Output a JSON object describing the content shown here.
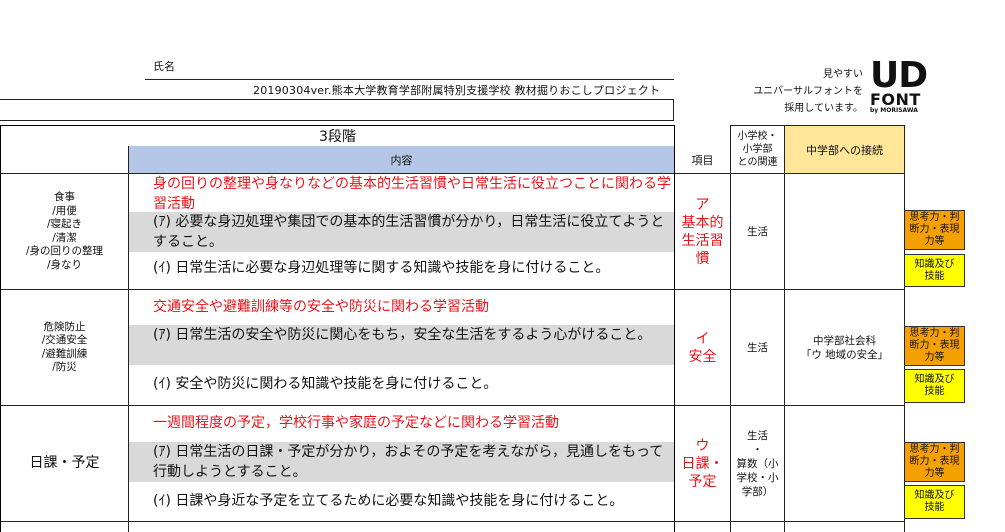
{
  "header": {
    "name_label": "氏名",
    "project_line": "20190304ver.熊本大学教育学部附属特別支援学校 教材掘りおこしプロジェクト"
  },
  "ud_font": {
    "tagline": "見やすい\nユニバーサルフォントを\n採用しています。",
    "logo_main": "UD",
    "logo_sub": "FONT",
    "logo_by": "by MORISAWA"
  },
  "table": {
    "stage": "3段階",
    "col_content": "内容",
    "col_item": "項目",
    "col_relation": "小学校・\n小学部\nとの関連",
    "col_junior": "中学部への接続",
    "rows": [
      {
        "category": "食事\n/用便\n/寝起き\n/清潔\n/身の回りの整理\n/身なり",
        "title": "身の回りの整理や身なりなどの基本的生活習慣や日常生活に役立つことに関わる学習活動",
        "objective_a": "(ｱ) 必要な身辺処理や集団での基本的生活習慣が分かり，日常生活に役立てようとすること。",
        "objective_b": "(ｲ) 日常生活に必要な身辺処理等に関する知識や技能を身に付けること。",
        "item": "ア\n基本的\n生活習\n慣",
        "relation": "生活",
        "junior": "",
        "tag_think": "思考力・判\n断力・表現\n力等",
        "tag_skill": "知識及び\n技能"
      },
      {
        "category": "危険防止\n/交通安全\n/避難訓練\n/防災",
        "title": "交通安全や避難訓練等の安全や防災に関わる学習活動",
        "objective_a": "(ｱ) 日常生活の安全や防災に関心をもち，安全な生活をするよう心がけること。",
        "objective_b": "(ｲ) 安全や防災に関わる知識や技能を身に付けること。",
        "item": "イ\n安全",
        "relation": "生活",
        "junior": "中学部社会科\n「ウ 地域の安全」",
        "tag_think": "思考力・判\n断力・表現\n力等",
        "tag_skill": "知識及び\n技能"
      },
      {
        "category": "日課・予定",
        "title": "一週間程度の予定，学校行事や家庭の予定などに関わる学習活動",
        "objective_a": "(ｱ) 日常生活の日課・予定が分かり，およその予定を考えながら，見通しをもって行動しようとすること。",
        "objective_b": "(ｲ) 日課や身近な予定を立てるために必要な知識や技能を身に付けること。",
        "item": "ウ\n日課・\n予定",
        "relation": "生活\n・\n算数（小\n学校・小\n学部）",
        "junior": "",
        "tag_think": "思考力・判\n断力・表現\n力等",
        "tag_skill": "知識及び\n技能"
      }
    ]
  }
}
